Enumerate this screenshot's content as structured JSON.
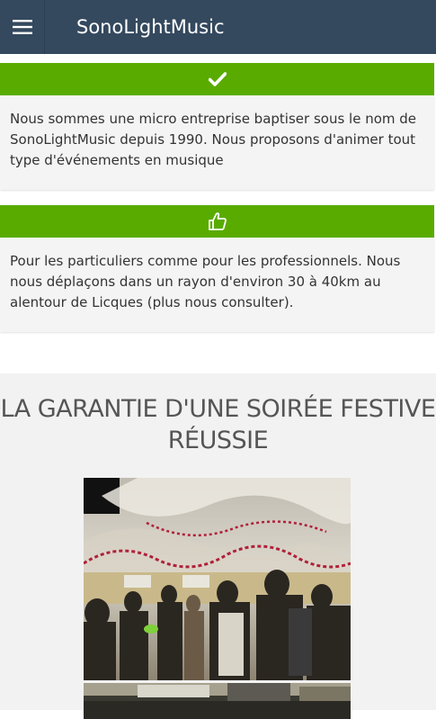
{
  "header": {
    "title": "SonoLightMusic",
    "menu_icon": "hamburger-icon",
    "background": "#34495e"
  },
  "cards": [
    {
      "icon": "checkmark-icon",
      "text": "Nous sommes une micro entreprise baptiser sous le nom de SonoLightMusic depuis 1990. Nous proposons d'animer tout type d'événements en musique"
    },
    {
      "icon": "thumbs-up-icon",
      "text": "Pour les particuliers comme pour les professionnels. Nous nous déplaçons dans un rayon d'environ 30 à 40km au alentour de Licques (plus nous consulter)."
    }
  ],
  "colors": {
    "accent_green": "#59ab00",
    "card_background": "#f4f4f4",
    "text": "#333333"
  },
  "section": {
    "title": "LA GARANTIE D'UNE SOIRÉE FESTIVE RÉUSSIE",
    "images": [
      {
        "description_icon": "party-photo"
      },
      {
        "description_icon": "party-photo"
      }
    ]
  }
}
